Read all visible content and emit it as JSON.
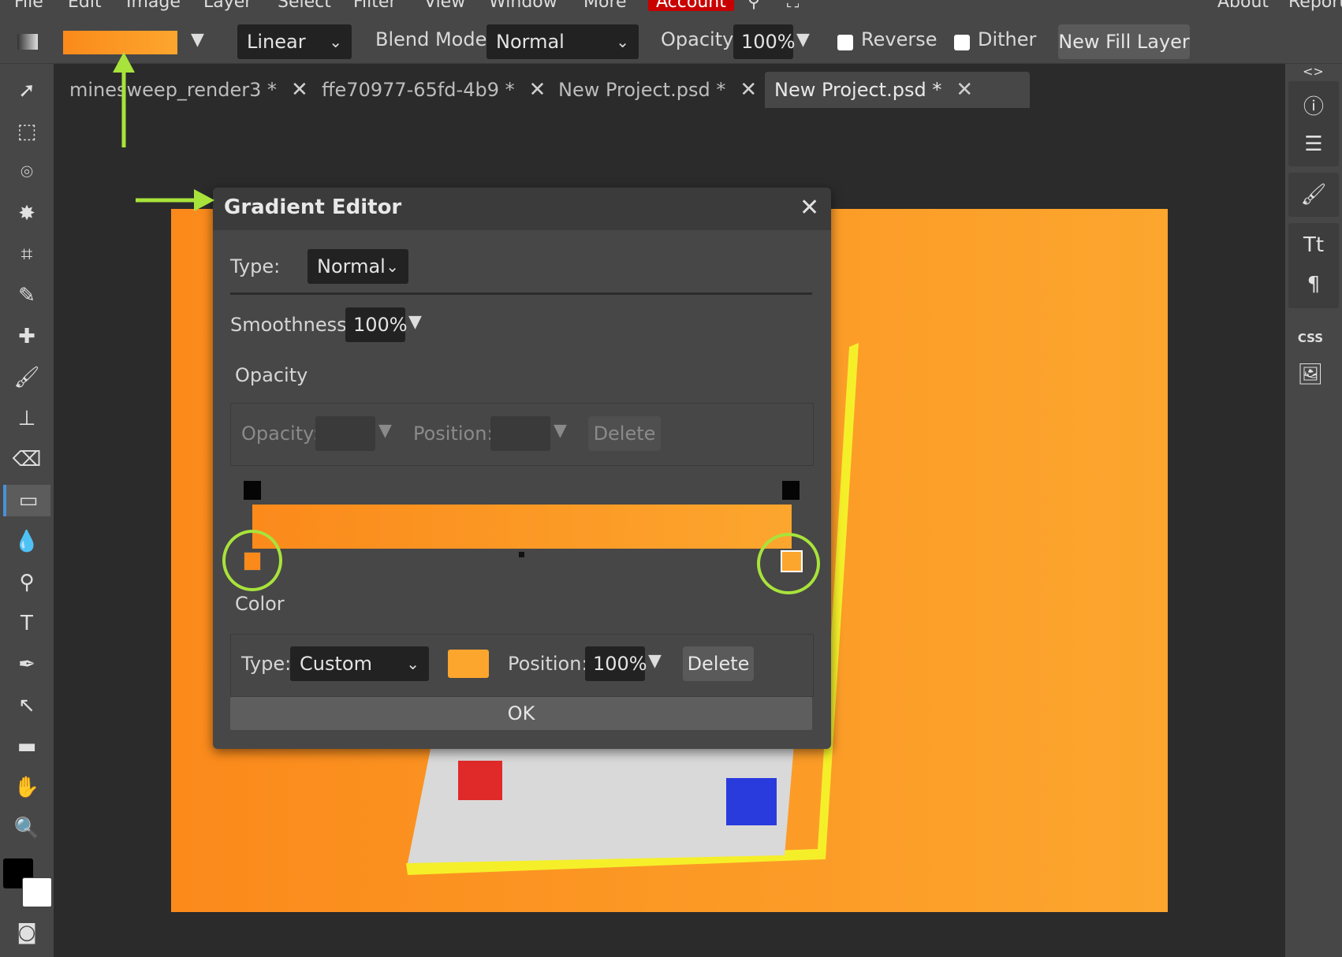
{
  "menu": {
    "items": [
      "File",
      "Edit",
      "Image",
      "Layer",
      "Select",
      "Filter",
      "View",
      "Window",
      "More"
    ],
    "account": "Account",
    "right_items": [
      "About",
      "Report"
    ]
  },
  "options_bar": {
    "gradient_type": "Linear",
    "blend_mode_label": "Blend Mode:",
    "blend_mode_value": "Normal",
    "opacity_label": "Opacity:",
    "opacity_value": "100%",
    "reverse_label": "Reverse",
    "dither_label": "Dither",
    "new_fill_layer": "New Fill Layer"
  },
  "tabs": [
    {
      "label": "minesweep_render3 *"
    },
    {
      "label": "ffe70977-65fd-4b9 *"
    },
    {
      "label": "New Project.psd *"
    },
    {
      "label": "New Project.psd *"
    }
  ],
  "right_panel": {
    "collapse": "<>",
    "css_label": "CSS"
  },
  "gradient_editor": {
    "title": "Gradient Editor",
    "type_label": "Type:",
    "type_value": "Normal",
    "smoothness_label": "Smoothness:",
    "smoothness_value": "100%",
    "opacity_section": "Opacity",
    "opacity_label": "Opacity:",
    "position_label": "Position:",
    "delete_label": "Delete",
    "color_section": "Color",
    "color_type_label": "Type:",
    "color_type_value": "Custom",
    "color_position_label": "Position:",
    "color_position_value": "100%",
    "ok_label": "OK"
  },
  "colors": {
    "gradient_start": "#fb8a1b",
    "gradient_end": "#fca62e",
    "annotation": "#a8e33b",
    "account_red": "#c80000"
  }
}
